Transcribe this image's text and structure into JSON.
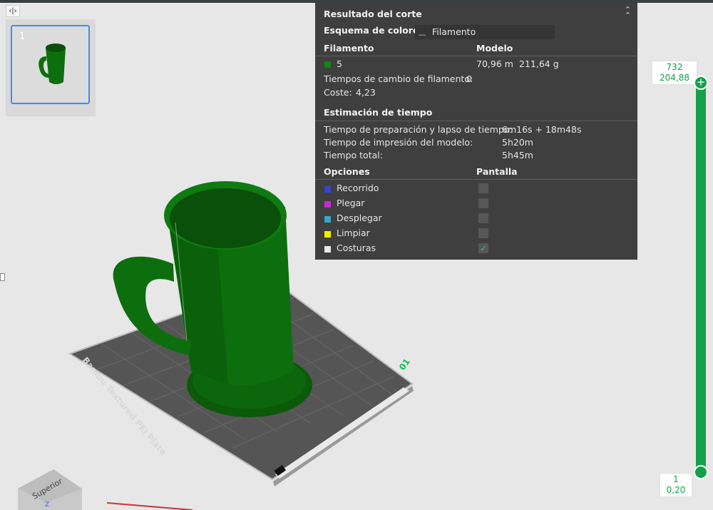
{
  "colors": {
    "accent": "#11a047",
    "filament": "#0d6e0d",
    "panel_bg": "#3f3f3f"
  },
  "thumbnail": {
    "index": "1"
  },
  "bed_label": "Bambu Textured PEI Plate",
  "bed_number": "01",
  "viewcube": {
    "face": "Superior",
    "axis": "Z"
  },
  "result": {
    "title": "Resultado del corte",
    "scheme_label": "Esquema de colores",
    "scheme_value": "Filamento",
    "col_filament": "Filamento",
    "col_model": "Modelo",
    "filament_id": "5",
    "filament_length": "70,96 m",
    "filament_weight": "211,64 g",
    "change_times_label": "Tiempos de cambio de filamento:",
    "change_times_value": "0",
    "cost_label": "Coste:",
    "cost_value": "4,23",
    "time_header": "Estimación de tiempo",
    "prep_label": "Tiempo de preparación y lapso de tiempo:",
    "prep_value": "6m16s + 18m48s",
    "print_label": "Tiempo de impresión del modelo:",
    "print_value": "5h20m",
    "total_label": "Tiempo total:",
    "total_value": "5h45m",
    "options_header": "Opciones",
    "display_header": "Pantalla",
    "options": [
      {
        "label": "Recorrido",
        "color": "#3a45c8",
        "checked": false
      },
      {
        "label": "Plegar",
        "color": "#c82ad0",
        "checked": false
      },
      {
        "label": "Desplegar",
        "color": "#36a7c9",
        "checked": false
      },
      {
        "label": "Limpiar",
        "color": "#f0f000",
        "checked": false
      },
      {
        "label": "Costuras",
        "color": "#e8e8e8",
        "checked": true
      }
    ]
  },
  "slider": {
    "top_layer": "732",
    "top_height": "204,88",
    "bottom_layer": "1",
    "bottom_height": "0,20"
  }
}
